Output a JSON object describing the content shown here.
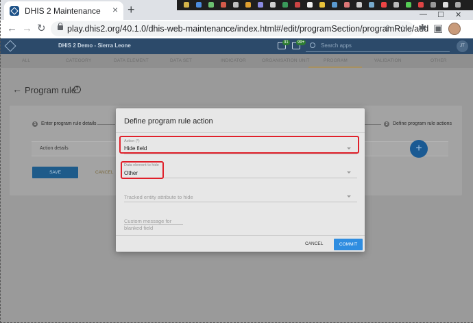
{
  "browser": {
    "tab_title": "DHIS 2 Maintenance",
    "tab_close": "×",
    "new_tab": "+",
    "url": "play.dhis2.org/40.1.0/dhis-web-maintenance/index.html#/edit/programSection/programRule/add",
    "window_controls": [
      "—",
      "☐",
      "✕"
    ]
  },
  "app": {
    "title": "DHIS 2 Demo - Sierra Leone",
    "messages_badge": "31",
    "interpretations_badge": "99+",
    "search_placeholder": "Search apps",
    "user_initials": "JT"
  },
  "section_tabs": [
    "ALL",
    "CATEGORY",
    "DATA ELEMENT",
    "DATA SET",
    "INDICATOR",
    "ORGANISATION UNIT",
    "PROGRAM",
    "VALIDATION",
    "OTHER"
  ],
  "active_section": "PROGRAM",
  "page": {
    "title": "Program rule",
    "help": "?",
    "steps": [
      {
        "num": "1",
        "label": "Enter program rule details"
      },
      {
        "num": "3",
        "label": "Define program rule actions"
      }
    ],
    "action_details_label": "Action details",
    "fab_label": "+",
    "save_label": "SAVE",
    "cancel_label": "CANCEL"
  },
  "dialog": {
    "title": "Define program rule action",
    "action": {
      "label": "Action (*)",
      "value": "Hide field"
    },
    "data_element": {
      "label": "Data element to hide",
      "value": "Other"
    },
    "tracked_entity_placeholder": "Tracked entity attribute to hide",
    "custom_message_placeholder_line1": "Custom message for",
    "custom_message_placeholder_line2": "blanked field",
    "cancel_label": "CANCEL",
    "commit_label": "COMMIT"
  },
  "colors": {
    "highlight": "#e0202a",
    "primary": "#2f8de0",
    "header": "#2c4a6a"
  }
}
